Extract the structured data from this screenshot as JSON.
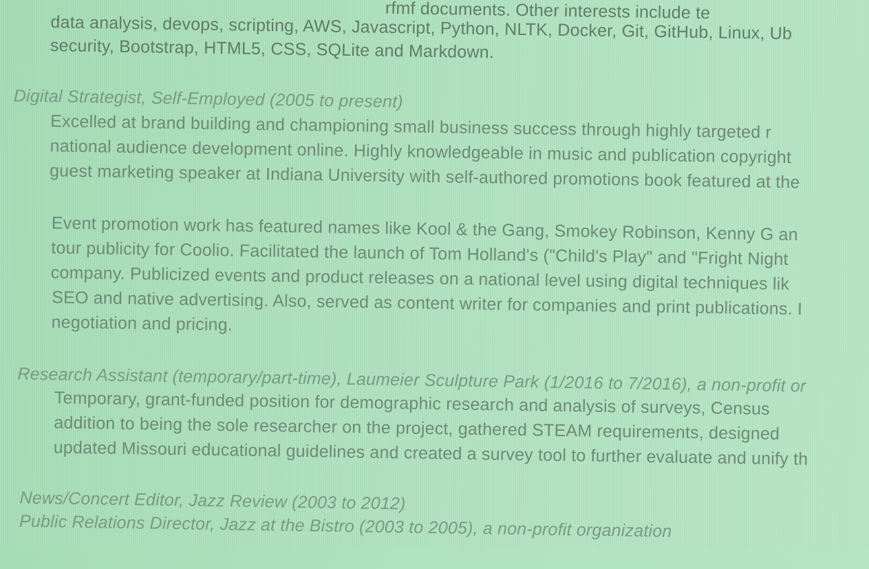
{
  "intro": {
    "line0": "rfmf documents. Other interests include te",
    "line1": "data analysis, devops, scripting, AWS, Javascript, Python, NLTK, Docker, Git, GitHub, Linux, Ub",
    "line2": "security, Bootstrap, HTML5, CSS, SQLite and Markdown."
  },
  "digital": {
    "heading": "Digital Strategist, Self-Employed (2005 to present)",
    "p1": [
      "Excelled at brand building and championing small business success through highly targeted r",
      "national audience development online. Highly knowledgeable in music and publication copyright",
      "guest marketing speaker at Indiana University with self-authored promotions book featured at the"
    ],
    "p2": [
      "Event promotion work has featured names like Kool & the Gang, Smokey Robinson, Kenny G an",
      "tour publicity for Coolio. Facilitated the launch of Tom Holland's (\"Child's Play\" and \"Fright Night",
      "company. Publicized events and product releases on a national level using digital techniques lik",
      "SEO and native advertising. Also, served as content writer for companies and print publications. I",
      "negotiation and pricing."
    ]
  },
  "research": {
    "heading": "Research Assistant (temporary/part-time), Laumeier Sculpture Park (1/2016 to 7/2016), a non-profit or",
    "lines": [
      "Temporary, grant-funded position for demographic research and analysis of surveys, Census",
      "addition to being the sole researcher on the project, gathered STEAM requirements, designed",
      "updated Missouri educational guidelines and created a survey tool to further evaluate and unify th"
    ]
  },
  "other_roles": {
    "jazz_review": "News/Concert Editor, Jazz Review (2003 to 2012)",
    "bistro": "Public Relations Director, Jazz at the Bistro (2003 to 2005), a non-profit organization"
  }
}
